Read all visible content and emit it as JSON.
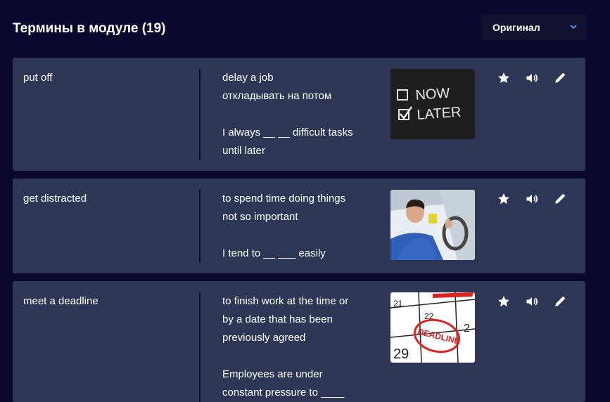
{
  "header": {
    "title": "Термины в модуле (19)"
  },
  "sort": {
    "selected": "Оригинал",
    "icon": "chevron-down-icon"
  },
  "cards": [
    {
      "term": "put off",
      "definition": "delay a job",
      "translation": "откладывать на потом",
      "example": [
        "I always __ __ difficult tasks",
        "until later"
      ],
      "image_text": [
        "NOW",
        "LATER"
      ]
    },
    {
      "term": "get distracted",
      "definition_lines": [
        "to spend time doing things",
        "not so important"
      ],
      "example": [
        "I tend to __ ___ easily"
      ]
    },
    {
      "term": "meet a deadline",
      "definition_lines": [
        "to finish work at the time or",
        "by a date that has been",
        "previously agreed"
      ],
      "example": [
        "Employees are under",
        "constant pressure to ____"
      ],
      "image_text": [
        "DEADLINE",
        "21",
        "22",
        "29",
        "2"
      ]
    }
  ],
  "icons": [
    "star-icon",
    "speaker-icon",
    "pencil-icon"
  ],
  "colors": {
    "background": "#0a092d",
    "card": "#2e3856",
    "select": "#121230",
    "accent": "#4da3ff"
  }
}
